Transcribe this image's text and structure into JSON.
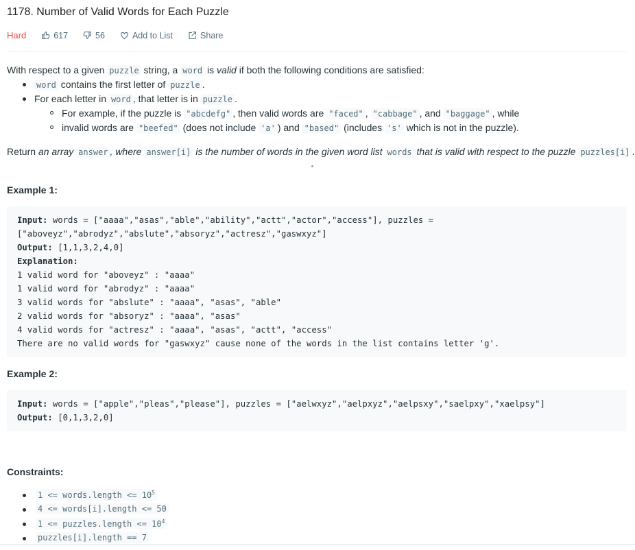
{
  "problem": {
    "title": "1178. Number of Valid Words for Each Puzzle",
    "difficulty": "Hard",
    "likes": "617",
    "dislikes": "56",
    "add_to_list": "Add to List",
    "share": "Share"
  },
  "description": {
    "intro": [
      "With respect to a given ",
      "puzzle",
      " string, a ",
      "word",
      " is ",
      "valid",
      " if both the following conditions are satisfied:"
    ],
    "bullet1": [
      "word",
      " contains the first letter of ",
      "puzzle",
      "."
    ],
    "bullet2": [
      "For each letter in ",
      "word",
      ", that letter is in ",
      "puzzle",
      "."
    ],
    "sub1": [
      "For example, if the puzzle is ",
      "\"abcdefg\"",
      ", then valid words are ",
      "\"faced\"",
      ", ",
      "\"cabbage\"",
      ", and ",
      "\"baggage\"",
      ", while"
    ],
    "sub2": [
      "invalid words are ",
      "\"beefed\"",
      " (does not include ",
      "'a'",
      ") and ",
      "\"based\"",
      " (includes ",
      "'s'",
      " which is not in the puzzle)."
    ],
    "return": [
      "Return ",
      "an array ",
      "answer",
      ", where ",
      "answer[i]",
      " is the number of words in the given word list ",
      "words",
      " that is valid with respect to the puzzle ",
      "puzzles[i]",
      "."
    ]
  },
  "example1": {
    "heading": "Example 1:",
    "input_label": "Input:",
    "input_line1": " words = [\"aaaa\",\"asas\",\"able\",\"ability\",\"actt\",\"actor\",\"access\"], puzzles =",
    "input_line2": "[\"aboveyz\",\"abrodyz\",\"abslute\",\"absoryz\",\"actresz\",\"gaswxyz\"]",
    "output_label": "Output:",
    "output_value": " [1,1,3,2,4,0]",
    "explanation_label": "Explanation:",
    "explanation_lines": [
      "1 valid word for \"aboveyz\" : \"aaaa\"",
      "1 valid word for \"abrodyz\" : \"aaaa\"",
      "3 valid words for \"abslute\" : \"aaaa\", \"asas\", \"able\"",
      "2 valid words for \"absoryz\" : \"aaaa\", \"asas\"",
      "4 valid words for \"actresz\" : \"aaaa\", \"asas\", \"actt\", \"access\"",
      "There are no valid words for \"gaswxyz\" cause none of the words in the list contains letter 'g'."
    ]
  },
  "example2": {
    "heading": "Example 2:",
    "input_label": "Input:",
    "input_value": " words = [\"apple\",\"pleas\",\"please\"], puzzles = [\"aelwxyz\",\"aelpxyz\",\"aelpsxy\",\"saelpxy\",\"xaelpsy\"]",
    "output_label": "Output:",
    "output_value": " [0,1,3,2,0]"
  },
  "constraints": {
    "heading": "Constraints:",
    "c1": "1 <= words.length <= 10",
    "c1_sup": "5",
    "c2": "4 <= words[i].length <= 50",
    "c3": "1 <= puzzles.length <= 10",
    "c3_sup": "4",
    "c4": "puzzles[i].length == 7"
  },
  "colors": {
    "hard": "#ef4743",
    "meta": "#546e7a",
    "code_bg": "#f7f9fa"
  },
  "icons": [
    "thumbs-up-icon",
    "thumbs-down-icon",
    "heart-icon",
    "share-icon"
  ]
}
